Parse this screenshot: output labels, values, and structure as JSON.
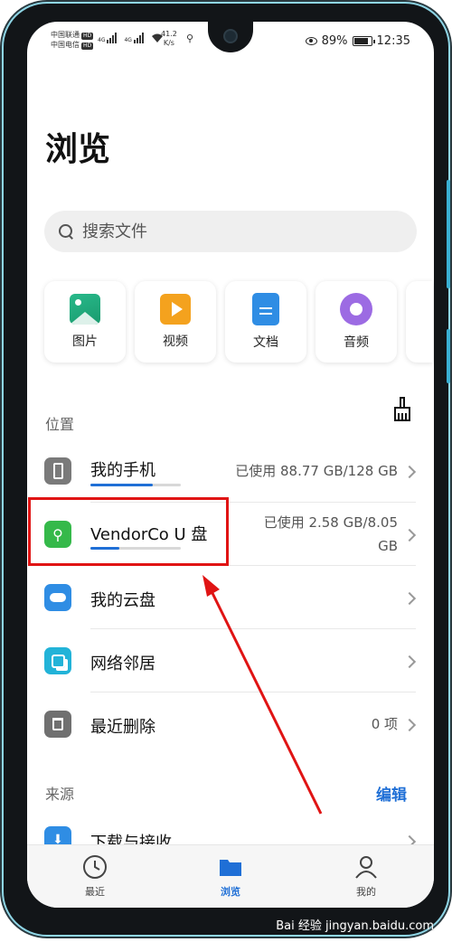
{
  "status_bar": {
    "carrier1": "中国联通",
    "carrier2": "中国电信",
    "hd": "HD",
    "net1": "4G",
    "net2": "4G",
    "speed_value": "41.2",
    "speed_unit": "K/s",
    "battery": "89%",
    "time": "12:35"
  },
  "page_title": "浏览",
  "search": {
    "placeholder": "搜索文件"
  },
  "categories": [
    {
      "label": "图片",
      "icon": "image-icon"
    },
    {
      "label": "视频",
      "icon": "video-icon"
    },
    {
      "label": "文档",
      "icon": "document-icon"
    },
    {
      "label": "音频",
      "icon": "audio-icon"
    }
  ],
  "locations": {
    "label": "位置",
    "clean_icon": "broom-icon",
    "items": [
      {
        "title": "我的手机",
        "meta": "已使用 88.77 GB/128 GB",
        "usage_fraction": 0.69
      },
      {
        "title": "VendorCo U 盘",
        "meta_line1": "已使用 2.58 GB/8.05",
        "meta_line2": "GB",
        "usage_fraction": 0.32
      },
      {
        "title": "我的云盘",
        "meta": ""
      },
      {
        "title": "网络邻居",
        "meta": ""
      },
      {
        "title": "最近删除",
        "meta": "0 项"
      }
    ]
  },
  "sources": {
    "label": "来源",
    "edit": "编辑",
    "items": [
      {
        "title": "下载与接收"
      }
    ]
  },
  "tabs": [
    {
      "label": "最近",
      "icon": "clock-icon"
    },
    {
      "label": "浏览",
      "icon": "folder-icon",
      "active": true
    },
    {
      "label": "我的",
      "icon": "person-icon"
    }
  ],
  "watermark": "Bai 经验 jingyan.baidu.com",
  "colors": {
    "accent": "#1f6fd6",
    "highlight": "#e01414"
  }
}
